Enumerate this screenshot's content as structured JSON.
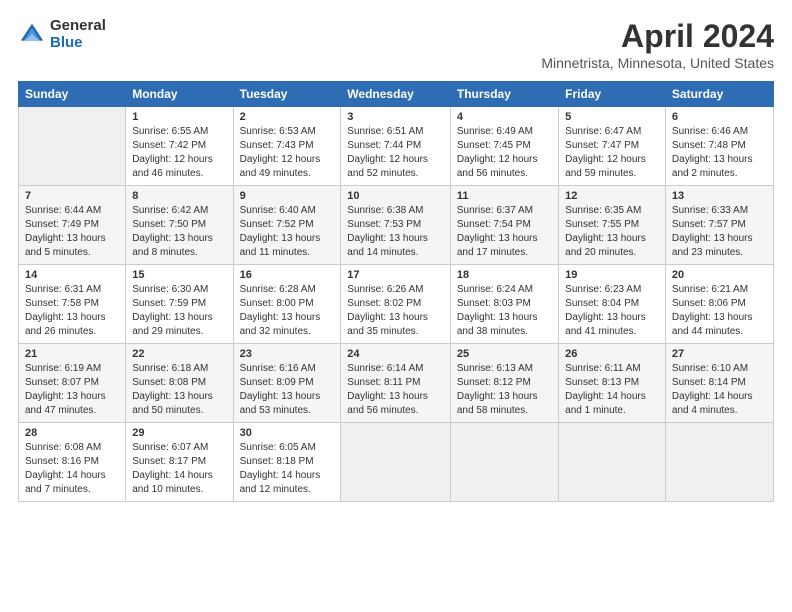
{
  "header": {
    "logo": {
      "general": "General",
      "blue": "Blue"
    },
    "title": "April 2024",
    "subtitle": "Minnetrista, Minnesota, United States"
  },
  "calendar": {
    "days_of_week": [
      "Sunday",
      "Monday",
      "Tuesday",
      "Wednesday",
      "Thursday",
      "Friday",
      "Saturday"
    ],
    "weeks": [
      [
        {
          "day": "",
          "content": ""
        },
        {
          "day": "1",
          "content": "Sunrise: 6:55 AM\nSunset: 7:42 PM\nDaylight: 12 hours\nand 46 minutes."
        },
        {
          "day": "2",
          "content": "Sunrise: 6:53 AM\nSunset: 7:43 PM\nDaylight: 12 hours\nand 49 minutes."
        },
        {
          "day": "3",
          "content": "Sunrise: 6:51 AM\nSunset: 7:44 PM\nDaylight: 12 hours\nand 52 minutes."
        },
        {
          "day": "4",
          "content": "Sunrise: 6:49 AM\nSunset: 7:45 PM\nDaylight: 12 hours\nand 56 minutes."
        },
        {
          "day": "5",
          "content": "Sunrise: 6:47 AM\nSunset: 7:47 PM\nDaylight: 12 hours\nand 59 minutes."
        },
        {
          "day": "6",
          "content": "Sunrise: 6:46 AM\nSunset: 7:48 PM\nDaylight: 13 hours\nand 2 minutes."
        }
      ],
      [
        {
          "day": "7",
          "content": "Sunrise: 6:44 AM\nSunset: 7:49 PM\nDaylight: 13 hours\nand 5 minutes."
        },
        {
          "day": "8",
          "content": "Sunrise: 6:42 AM\nSunset: 7:50 PM\nDaylight: 13 hours\nand 8 minutes."
        },
        {
          "day": "9",
          "content": "Sunrise: 6:40 AM\nSunset: 7:52 PM\nDaylight: 13 hours\nand 11 minutes."
        },
        {
          "day": "10",
          "content": "Sunrise: 6:38 AM\nSunset: 7:53 PM\nDaylight: 13 hours\nand 14 minutes."
        },
        {
          "day": "11",
          "content": "Sunrise: 6:37 AM\nSunset: 7:54 PM\nDaylight: 13 hours\nand 17 minutes."
        },
        {
          "day": "12",
          "content": "Sunrise: 6:35 AM\nSunset: 7:55 PM\nDaylight: 13 hours\nand 20 minutes."
        },
        {
          "day": "13",
          "content": "Sunrise: 6:33 AM\nSunset: 7:57 PM\nDaylight: 13 hours\nand 23 minutes."
        }
      ],
      [
        {
          "day": "14",
          "content": "Sunrise: 6:31 AM\nSunset: 7:58 PM\nDaylight: 13 hours\nand 26 minutes."
        },
        {
          "day": "15",
          "content": "Sunrise: 6:30 AM\nSunset: 7:59 PM\nDaylight: 13 hours\nand 29 minutes."
        },
        {
          "day": "16",
          "content": "Sunrise: 6:28 AM\nSunset: 8:00 PM\nDaylight: 13 hours\nand 32 minutes."
        },
        {
          "day": "17",
          "content": "Sunrise: 6:26 AM\nSunset: 8:02 PM\nDaylight: 13 hours\nand 35 minutes."
        },
        {
          "day": "18",
          "content": "Sunrise: 6:24 AM\nSunset: 8:03 PM\nDaylight: 13 hours\nand 38 minutes."
        },
        {
          "day": "19",
          "content": "Sunrise: 6:23 AM\nSunset: 8:04 PM\nDaylight: 13 hours\nand 41 minutes."
        },
        {
          "day": "20",
          "content": "Sunrise: 6:21 AM\nSunset: 8:06 PM\nDaylight: 13 hours\nand 44 minutes."
        }
      ],
      [
        {
          "day": "21",
          "content": "Sunrise: 6:19 AM\nSunset: 8:07 PM\nDaylight: 13 hours\nand 47 minutes."
        },
        {
          "day": "22",
          "content": "Sunrise: 6:18 AM\nSunset: 8:08 PM\nDaylight: 13 hours\nand 50 minutes."
        },
        {
          "day": "23",
          "content": "Sunrise: 6:16 AM\nSunset: 8:09 PM\nDaylight: 13 hours\nand 53 minutes."
        },
        {
          "day": "24",
          "content": "Sunrise: 6:14 AM\nSunset: 8:11 PM\nDaylight: 13 hours\nand 56 minutes."
        },
        {
          "day": "25",
          "content": "Sunrise: 6:13 AM\nSunset: 8:12 PM\nDaylight: 13 hours\nand 58 minutes."
        },
        {
          "day": "26",
          "content": "Sunrise: 6:11 AM\nSunset: 8:13 PM\nDaylight: 14 hours\nand 1 minute."
        },
        {
          "day": "27",
          "content": "Sunrise: 6:10 AM\nSunset: 8:14 PM\nDaylight: 14 hours\nand 4 minutes."
        }
      ],
      [
        {
          "day": "28",
          "content": "Sunrise: 6:08 AM\nSunset: 8:16 PM\nDaylight: 14 hours\nand 7 minutes."
        },
        {
          "day": "29",
          "content": "Sunrise: 6:07 AM\nSunset: 8:17 PM\nDaylight: 14 hours\nand 10 minutes."
        },
        {
          "day": "30",
          "content": "Sunrise: 6:05 AM\nSunset: 8:18 PM\nDaylight: 14 hours\nand 12 minutes."
        },
        {
          "day": "",
          "content": ""
        },
        {
          "day": "",
          "content": ""
        },
        {
          "day": "",
          "content": ""
        },
        {
          "day": "",
          "content": ""
        }
      ]
    ]
  }
}
